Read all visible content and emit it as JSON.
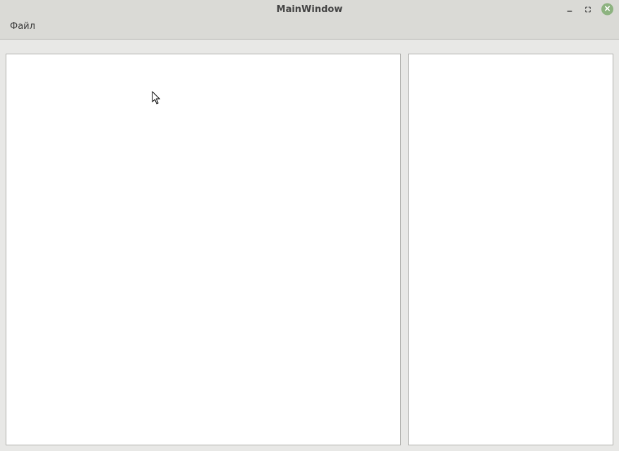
{
  "window": {
    "title": "MainWindow"
  },
  "menubar": {
    "file_label": "Файл"
  }
}
